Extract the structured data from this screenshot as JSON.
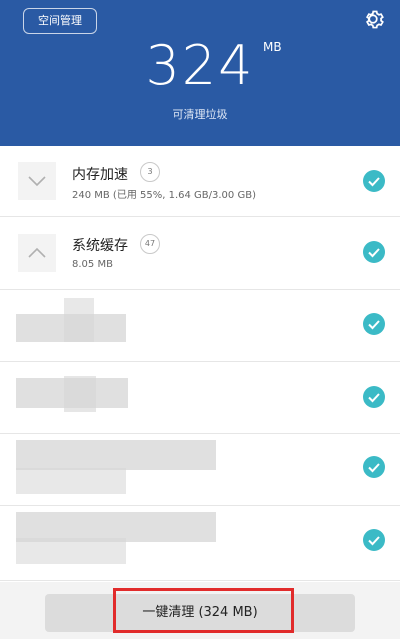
{
  "header": {
    "space_button": "空间管理",
    "amount": "324",
    "unit": "MB",
    "subtitle": "可清理垃圾",
    "settings_icon": "gear-icon",
    "bg_color": "#2a5aa4"
  },
  "items": [
    {
      "title": "内存加速",
      "badge": "3",
      "detail": "240 MB (已用 55%, 1.64 GB/3.00 GB)",
      "expanded": false,
      "checked": true
    },
    {
      "title": "系统缓存",
      "badge": "47",
      "detail": "8.05 MB",
      "expanded": true,
      "checked": true
    }
  ],
  "blurred_rows_checked": [
    true,
    true,
    true,
    true
  ],
  "action": {
    "clean_button": "一键清理 (324 MB)"
  },
  "accent_color": "#3bbac6"
}
